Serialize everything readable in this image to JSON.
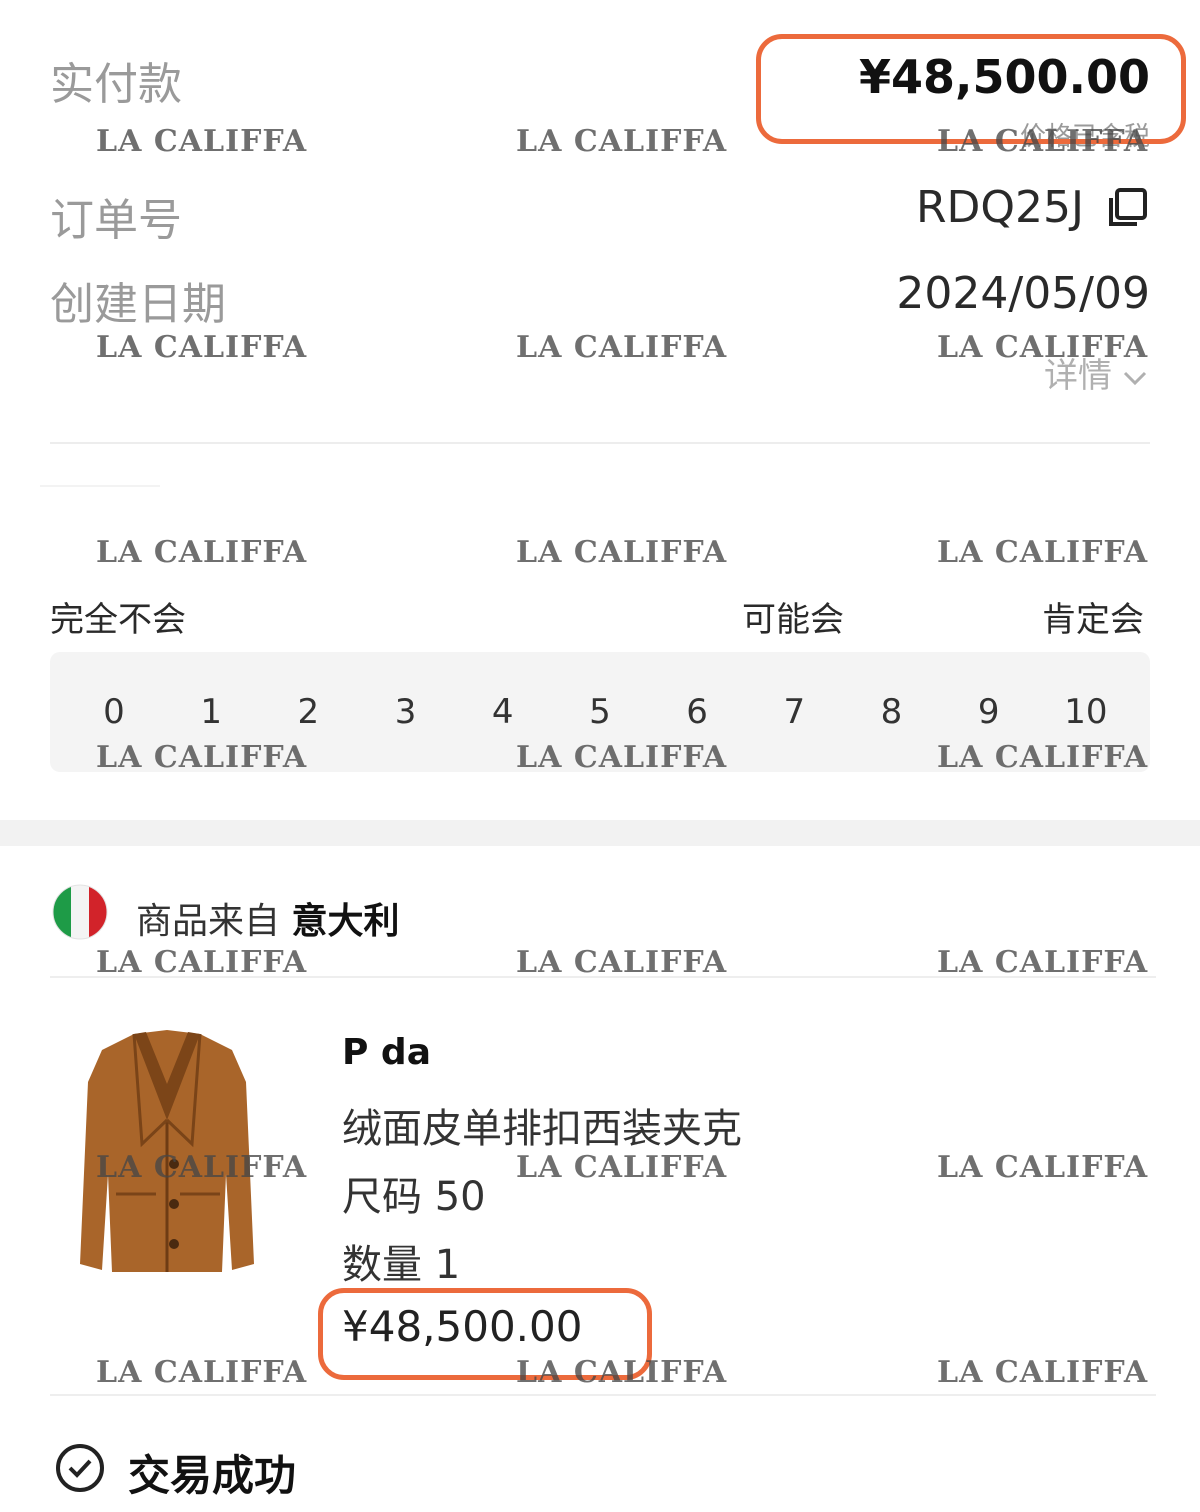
{
  "order": {
    "paid_label": "实付款",
    "paid_amount": "¥48,500.00",
    "tax_note": "价格已含税",
    "order_no_label": "订单号",
    "order_no": "RDQ25J",
    "created_label": "创建日期",
    "created_date": "2024/05/09",
    "details_label": "详情"
  },
  "survey": {
    "left_label": "完全不会",
    "mid_label": "可能会",
    "right_label": "肯定会",
    "scale": [
      "0",
      "1",
      "2",
      "3",
      "4",
      "5",
      "6",
      "7",
      "8",
      "9",
      "10"
    ]
  },
  "origin": {
    "prefix": "商品来自",
    "country": "意大利",
    "flag_colors": [
      "#1e9b47",
      "#f4f4f4",
      "#d2232a"
    ]
  },
  "product": {
    "brand": "P   da",
    "name": "绒面皮单排扣西装夹克",
    "size": "尺码 50",
    "quantity": "数量 1",
    "price": "¥48,500.00",
    "image_color": "#a9652a"
  },
  "status": {
    "text": "交易成功"
  },
  "watermark": "LA CALIFFA",
  "highlight_color": "#ec6a3c"
}
